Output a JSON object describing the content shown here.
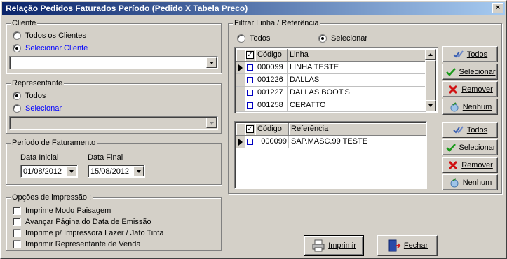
{
  "window": {
    "title": "Relação Pedidos Faturados Período (Pedido X Tabela Preco)",
    "close_glyph": "×"
  },
  "cliente": {
    "legend": "Cliente",
    "option_all": "Todos os Clientes",
    "option_select": "Selecionar Cliente",
    "selected": "Selecionar Cliente",
    "combo_value": ""
  },
  "representante": {
    "legend": "Representante",
    "option_all": "Todos",
    "option_select": "Selecionar",
    "selected": "Todos",
    "combo_value": ""
  },
  "periodo": {
    "legend": "Período de Faturamento",
    "start_label": "Data Inicial",
    "end_label": "Data Final",
    "start_value": "01/08/2012",
    "end_value": "15/08/2012"
  },
  "opcoes": {
    "legend": "Opções de impressão :",
    "items": [
      {
        "label": "Imprime Modo Paisagem",
        "checked": false
      },
      {
        "label": "Avançar Página do Data de Emissão",
        "checked": false
      },
      {
        "label": "Imprime p/ Impressora Lazer / Jato Tinta",
        "checked": false
      },
      {
        "label": "Imprimir Representante de Venda",
        "checked": false
      }
    ]
  },
  "filtro": {
    "legend": "Filtrar Linha / Referência",
    "option_all": "Todos",
    "option_select": "Selecionar",
    "selected": "Selecionar"
  },
  "linhas_grid": {
    "headers": [
      "",
      "Código",
      "Linha"
    ],
    "rows": [
      {
        "code": "000099",
        "name": "LINHA TESTE",
        "current": true
      },
      {
        "code": "001226",
        "name": "DALLAS",
        "current": false
      },
      {
        "code": "001227",
        "name": "DALLAS BOOT'S",
        "current": false
      },
      {
        "code": "001258",
        "name": "CERATTO",
        "current": false
      }
    ]
  },
  "referencias_grid": {
    "headers": [
      "",
      "Código",
      "Referência"
    ],
    "rows": [
      {
        "code": "000099",
        "name": "SAP.MASC.99 TESTE",
        "current": true
      }
    ]
  },
  "side_buttons": {
    "todos": "Todos",
    "selecionar": "Selecionar",
    "remover": "Remover",
    "nenhum": "Nenhum"
  },
  "footer": {
    "print_label": "Imprimir",
    "close_label": "Fechar"
  },
  "icons": {
    "check_multi": "double-check-icon",
    "check": "check-icon",
    "remove": "red-x-icon",
    "none": "clear-icon",
    "print": "printer-icon",
    "close": "door-exit-icon"
  },
  "colors": {
    "title_start": "#0a246a",
    "title_end": "#a6caf0",
    "face": "#d4d0c8",
    "link_blue": "#0000ff"
  }
}
